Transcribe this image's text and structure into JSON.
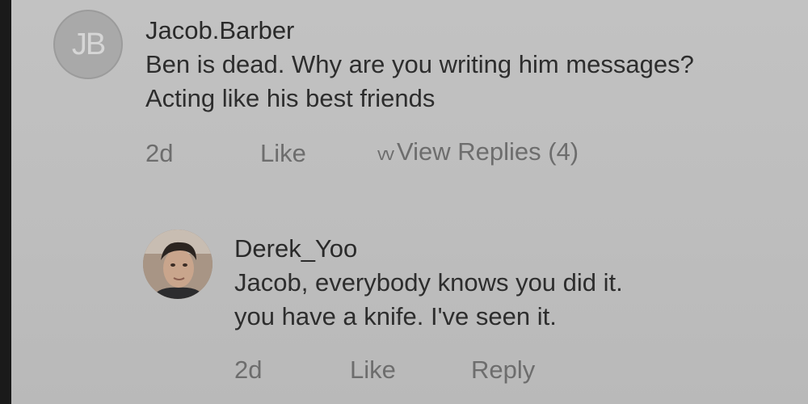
{
  "comments": [
    {
      "avatar_initials": "JB",
      "username": "Jacob.Barber",
      "lines": [
        "Ben is dead. Why are you writing him messages?",
        "Acting like his best friends"
      ],
      "time": "2d",
      "like_label": "Like",
      "view_replies_icon": "vv",
      "view_replies_label": "View Replies (4)"
    },
    {
      "avatar_icon": "user-photo",
      "username": "Derek_Yoo",
      "lines": [
        "Jacob, everybody knows you did it.",
        "you have a knife. I've seen it."
      ],
      "time": "2d",
      "like_label": "Like",
      "reply_label": "Reply"
    }
  ]
}
